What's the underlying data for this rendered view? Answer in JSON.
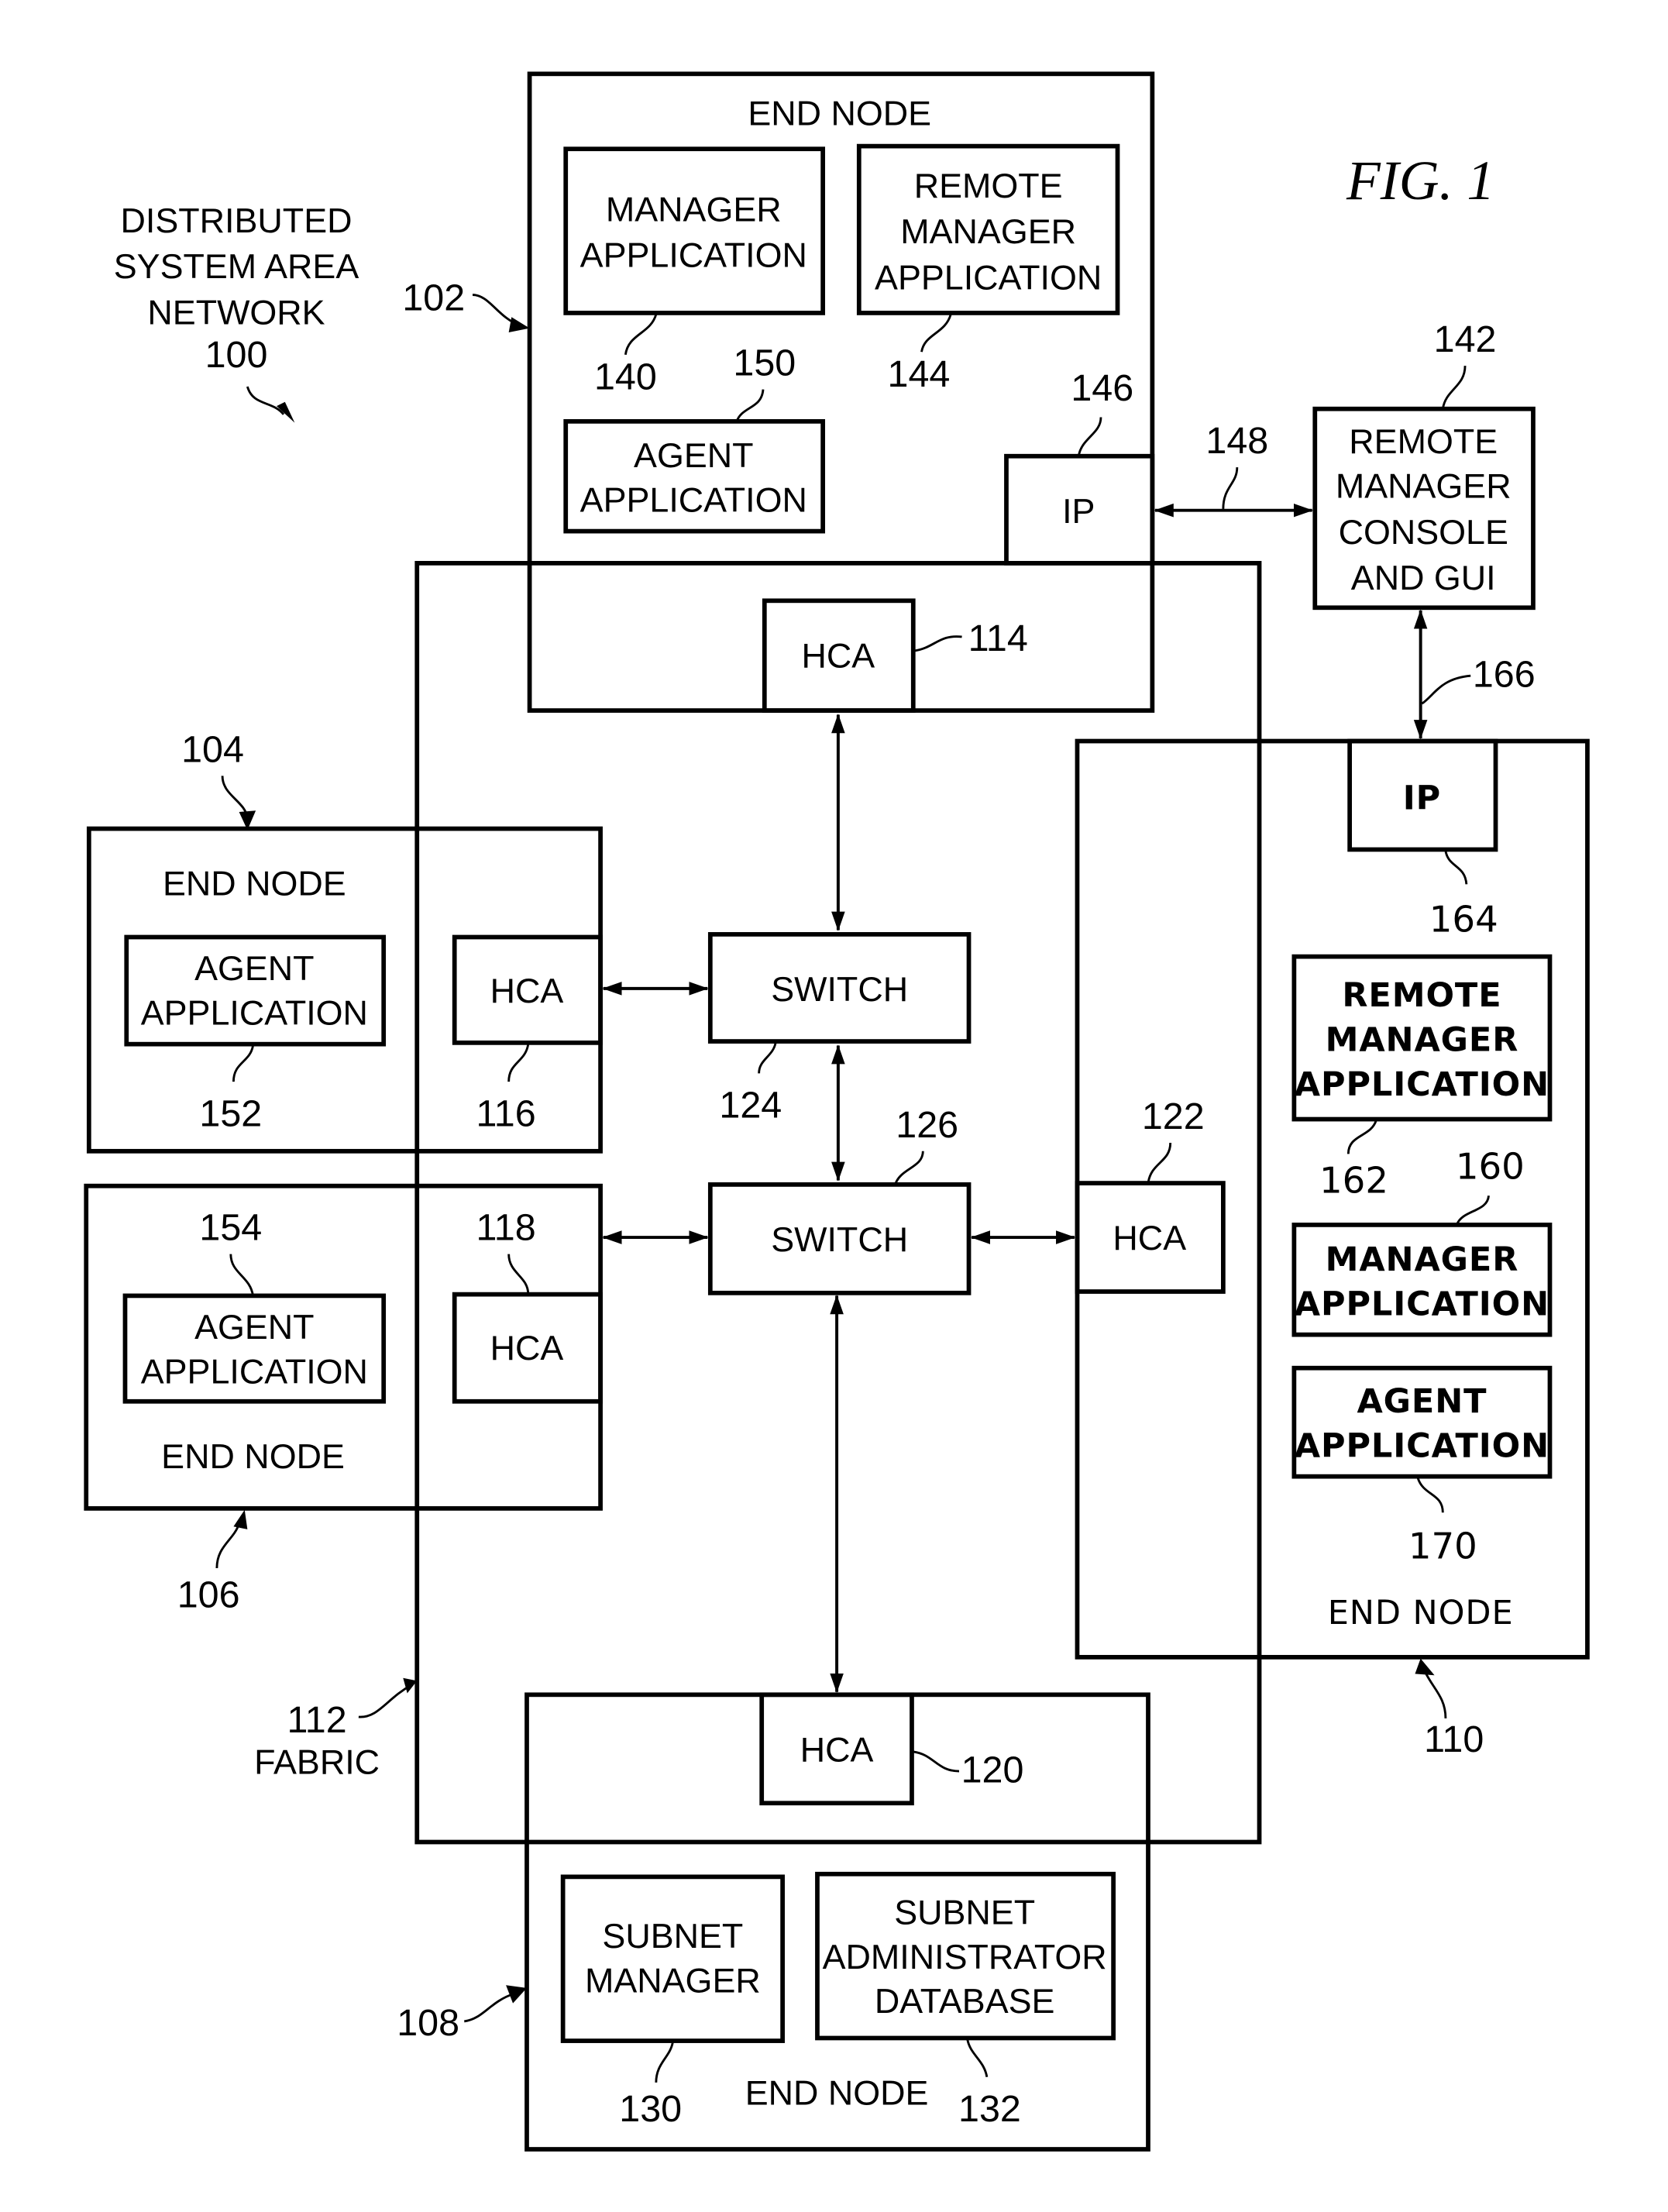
{
  "figure_title": "FIG. 1",
  "network": {
    "title_lines": [
      "DISTRIBUTED",
      "SYSTEM AREA",
      "NETWORK"
    ],
    "ref": "100"
  },
  "fabric": {
    "label": "FABRIC",
    "ref": "112"
  },
  "nodes": {
    "n102": {
      "ref": "102",
      "title": "END NODE",
      "manager_app": {
        "lines": [
          "MANAGER",
          "APPLICATION"
        ],
        "ref": "140"
      },
      "remote_manager_app": {
        "lines": [
          "REMOTE",
          "MANAGER",
          "APPLICATION"
        ],
        "ref": "144"
      },
      "agent_app": {
        "lines": [
          "AGENT",
          "APPLICATION"
        ],
        "ref": "150"
      },
      "ip": {
        "label": "IP",
        "ref": "146"
      },
      "hca": {
        "label": "HCA",
        "ref": "114"
      }
    },
    "n104": {
      "ref": "104",
      "title": "END NODE",
      "agent_app": {
        "lines": [
          "AGENT",
          "APPLICATION"
        ],
        "ref": "152"
      },
      "hca": {
        "label": "HCA",
        "ref": "116"
      }
    },
    "n106": {
      "ref": "106",
      "title": "END NODE",
      "agent_app": {
        "lines": [
          "AGENT",
          "APPLICATION"
        ],
        "ref": "154"
      },
      "hca": {
        "label": "HCA",
        "ref": "118"
      }
    },
    "n108": {
      "ref": "108",
      "title": "END NODE",
      "hca": {
        "label": "HCA",
        "ref": "120"
      },
      "subnet_manager": {
        "lines": [
          "SUBNET",
          "MANAGER"
        ],
        "ref": "130"
      },
      "subnet_admin_db": {
        "lines": [
          "SUBNET",
          "ADMINISTRATOR",
          "DATABASE"
        ],
        "ref": "132"
      }
    },
    "n110": {
      "ref": "110",
      "title": "END NODE",
      "ip": {
        "label": "IP",
        "ref": "164"
      },
      "remote_manager_app": {
        "lines": [
          "REMOTE",
          "MANAGER",
          "APPLICATION"
        ],
        "ref": "162"
      },
      "manager_app": {
        "lines": [
          "MANAGER",
          "APPLICATION"
        ],
        "ref": "160"
      },
      "agent_app": {
        "lines": [
          "AGENT",
          "APPLICATION"
        ],
        "ref": "170"
      },
      "hca": {
        "label": "HCA",
        "ref": "122"
      }
    }
  },
  "switches": [
    {
      "label": "SWITCH",
      "ref": "124"
    },
    {
      "label": "SWITCH",
      "ref": "126"
    }
  ],
  "console": {
    "lines": [
      "REMOTE",
      "MANAGER",
      "CONSOLE",
      "AND GUI"
    ],
    "ref": "142"
  },
  "links": {
    "ip_console_ref": "148",
    "console_ip_ref": "166"
  }
}
